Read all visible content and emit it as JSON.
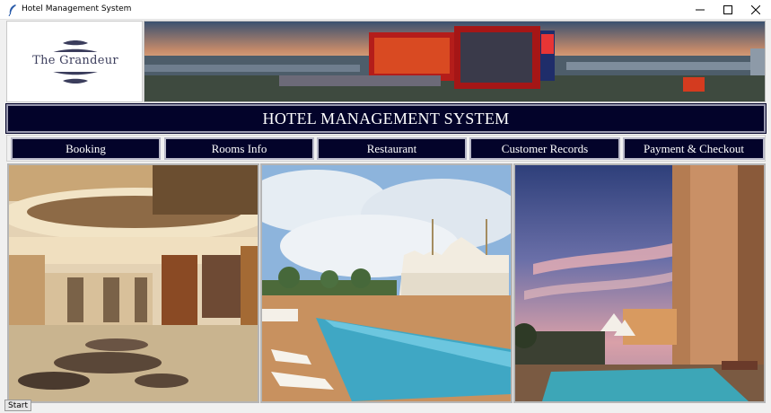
{
  "window": {
    "title": "Hotel Management System",
    "icon": "feather-icon",
    "controls": [
      "minimize-icon",
      "maximize-icon",
      "close-icon"
    ]
  },
  "logo": {
    "text": "The Grandeur"
  },
  "header": {
    "title": "HOTEL MANAGEMENT SYSTEM"
  },
  "nav": {
    "items": [
      {
        "label": "Booking"
      },
      {
        "label": "Rooms Info"
      },
      {
        "label": "Restaurant"
      },
      {
        "label": "Customer Records"
      },
      {
        "label": "Payment & Checkout"
      }
    ]
  },
  "gallery": {
    "images": [
      "hotel-lobby",
      "rooftop-pool-with-tents",
      "pool-at-dusk"
    ]
  },
  "taskbar": {
    "start_label": "Start"
  },
  "colors": {
    "navy": "#03032a",
    "header_text": "#ffffff",
    "logo_ink": "#3b3d5c"
  }
}
